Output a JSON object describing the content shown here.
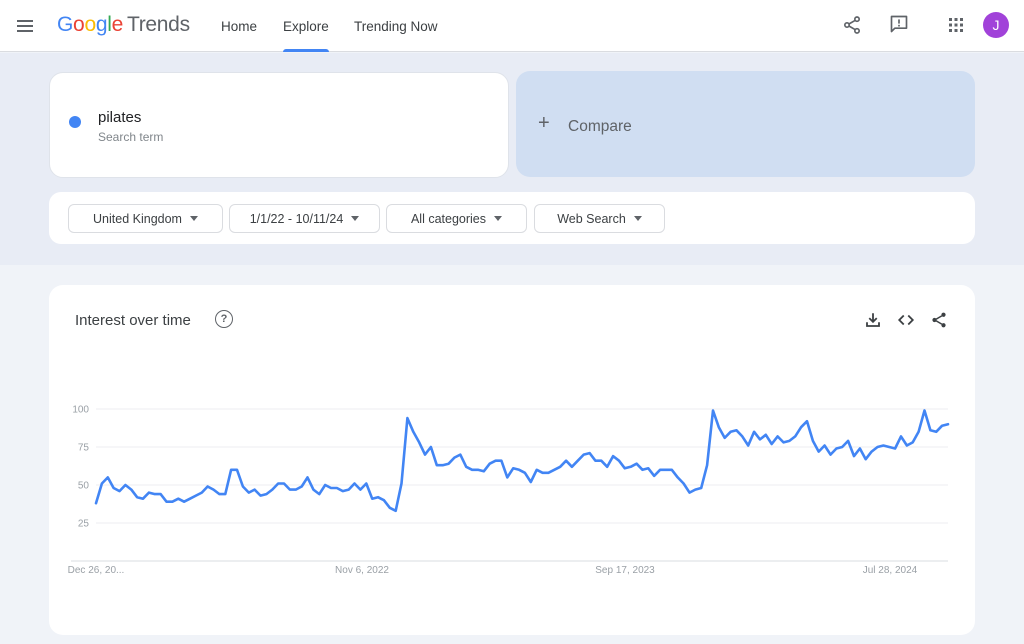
{
  "header": {
    "logo": {
      "google": [
        "G",
        "o",
        "o",
        "g",
        "l",
        "e"
      ],
      "product": "Trends"
    },
    "nav": [
      {
        "label": "Home",
        "active": false
      },
      {
        "label": "Explore",
        "active": true
      },
      {
        "label": "Trending Now",
        "active": false
      }
    ],
    "icons": [
      "share-icon",
      "feedback-icon",
      "apps-grid-icon"
    ],
    "avatar_initial": "J",
    "avatar_color": "#a142d9"
  },
  "search": {
    "term": "pilates",
    "term_type": "Search term",
    "term_color": "#4285f4",
    "compare_label": "Compare",
    "compare_icon": "+"
  },
  "filters": [
    {
      "label": "United Kingdom"
    },
    {
      "label": "1/1/22 - 10/11/24"
    },
    {
      "label": "All categories"
    },
    {
      "label": "Web Search"
    }
  ],
  "interest_card": {
    "title": "Interest over time",
    "help_icon": "?",
    "actions": [
      "download-icon",
      "embed-icon",
      "share-icon"
    ]
  },
  "chart_data": {
    "type": "line",
    "title": "Interest over time",
    "xlabel": "",
    "ylabel": "",
    "ylim": [
      0,
      100
    ],
    "yticks": [
      25,
      50,
      75,
      100
    ],
    "x_tick_labels": [
      "Dec 26, 20...",
      "Nov 6, 2022",
      "Sep 17, 2023",
      "Jul 28, 2024"
    ],
    "x_start": "Dec 26, 2021",
    "x_interval": "weekly",
    "grid": true,
    "legend": "none",
    "series": [
      {
        "name": "pilates",
        "color": "#4285f4",
        "values": [
          38,
          51,
          55,
          48,
          46,
          50,
          47,
          42,
          41,
          45,
          44,
          44,
          39,
          39,
          41,
          39,
          41,
          43,
          45,
          49,
          47,
          44,
          44,
          60,
          60,
          49,
          45,
          47,
          43,
          44,
          47,
          51,
          51,
          47,
          47,
          49,
          55,
          47,
          44,
          50,
          48,
          48,
          46,
          47,
          51,
          47,
          51,
          41,
          42,
          40,
          35,
          33,
          51,
          94,
          85,
          78,
          70,
          75,
          63,
          63,
          64,
          68,
          70,
          62,
          60,
          60,
          59,
          64,
          66,
          66,
          55,
          61,
          60,
          58,
          52,
          60,
          58,
          58,
          60,
          62,
          66,
          62,
          66,
          70,
          71,
          66,
          66,
          62,
          69,
          66,
          61,
          62,
          64,
          60,
          61,
          56,
          60,
          60,
          60,
          55,
          51,
          45,
          47,
          48,
          63,
          99,
          88,
          81,
          85,
          86,
          82,
          76,
          85,
          80,
          83,
          77,
          82,
          78,
          79,
          82,
          88,
          92,
          79,
          72,
          76,
          70,
          74,
          75,
          79,
          69,
          74,
          67,
          72,
          75,
          76,
          75,
          74,
          82,
          76,
          78,
          85,
          99,
          86,
          85,
          89,
          90
        ]
      }
    ]
  }
}
